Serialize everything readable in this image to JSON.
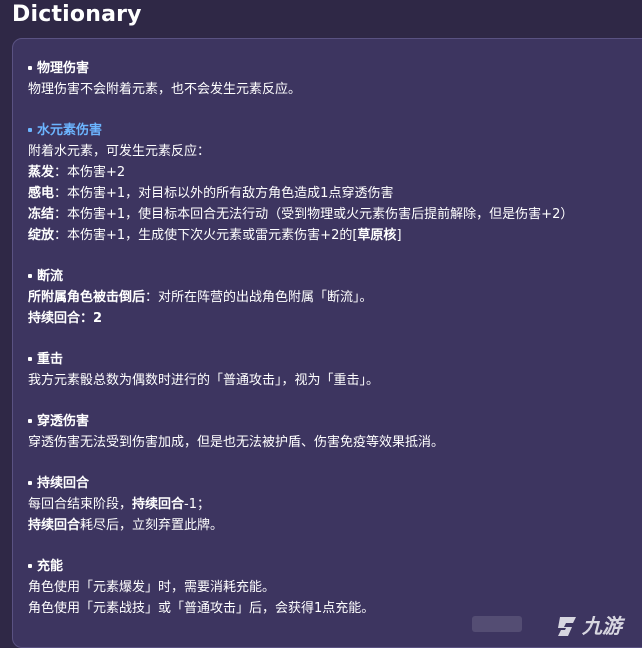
{
  "title": "Dictionary",
  "entries": [
    {
      "heading": "物理伤害",
      "hydro": false,
      "lines": [
        {
          "term": "",
          "text": "物理伤害不会附着元素，也不会发生元素反应。"
        }
      ]
    },
    {
      "heading": "水元素伤害",
      "hydro": true,
      "lines": [
        {
          "term": "",
          "text": "附着水元素，可发生元素反应："
        },
        {
          "term": "蒸发",
          "text": "：本伤害+2"
        },
        {
          "term": "感电",
          "text": "：本伤害+1，对目标以外的所有敌方角色造成1点穿透伤害"
        },
        {
          "term": "冻结",
          "text": "：本伤害+1，使目标本回合无法行动（受到物理或火元素伤害后提前解除，但是伤害+2）"
        },
        {
          "term": "绽放",
          "text": "：本伤害+1，生成使下次火元素或雷元素伤害+2的[",
          "term2": "草原核",
          "text2": "]"
        }
      ]
    },
    {
      "heading": "断流",
      "hydro": false,
      "lines": [
        {
          "term": "所附属角色被击倒后",
          "text": "：对所在阵营的出战角色附属「断流」。"
        },
        {
          "term": "持续回合：2",
          "text": ""
        }
      ]
    },
    {
      "heading": "重击",
      "hydro": false,
      "lines": [
        {
          "term": "",
          "text": "我方元素骰总数为偶数时进行的「普通攻击」，视为「重击」。"
        }
      ]
    },
    {
      "heading": "穿透伤害",
      "hydro": false,
      "lines": [
        {
          "term": "",
          "text": "穿透伤害无法受到伤害加成，但是也无法被护盾、伤害免疫等效果抵消。"
        }
      ]
    },
    {
      "heading": "持续回合",
      "hydro": false,
      "lines": [
        {
          "term": "",
          "text": "每回合结束阶段，",
          "term2": "持续回合",
          "text2": "-1；"
        },
        {
          "term": "持续回合",
          "text": "耗尽后，立刻弃置此牌。"
        }
      ]
    },
    {
      "heading": "充能",
      "hydro": false,
      "lines": [
        {
          "term": "",
          "text": "角色使用「元素爆发」时，需要消耗充能。"
        },
        {
          "term": "",
          "text": "角色使用「元素战技」或「普通攻击」后，会获得1点充能。"
        }
      ]
    }
  ],
  "watermark": "九游"
}
